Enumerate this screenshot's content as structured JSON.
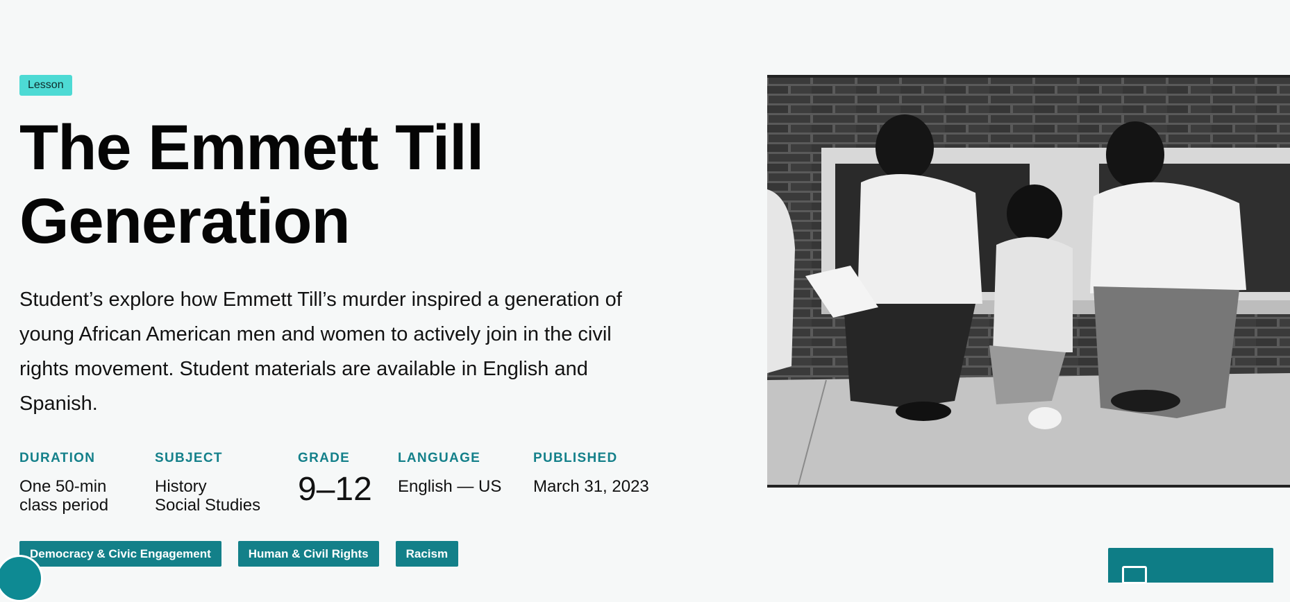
{
  "badge": "Lesson",
  "title_line1": "The Emmett Till",
  "title_line2": "Generation",
  "description": "Student’s explore how Emmett Till’s murder inspired a generation of young African American men and women to actively join in the civil rights movement. Student materials are available in English and Spanish.",
  "meta": {
    "duration": {
      "label": "DURATION",
      "line1": "One 50-min",
      "line2": "class period"
    },
    "subject": {
      "label": "SUBJECT",
      "line1": "History",
      "line2": "Social Studies"
    },
    "grade": {
      "label": "GRADE",
      "value": "9–12"
    },
    "language": {
      "label": "LANGUAGE",
      "value": "English — US"
    },
    "published": {
      "label": "PUBLISHED",
      "value": "March 31, 2023"
    }
  },
  "tags": [
    "Democracy & Civic Engagement",
    "Human & Civil Rights",
    "Racism"
  ],
  "colors": {
    "background": "#f6f8f8",
    "badge": "#4ddad4",
    "accent": "#138089",
    "meta_label": "#14808a"
  },
  "icons": {
    "chat_widget": "help-widget-icon",
    "cta": "document-icon"
  }
}
